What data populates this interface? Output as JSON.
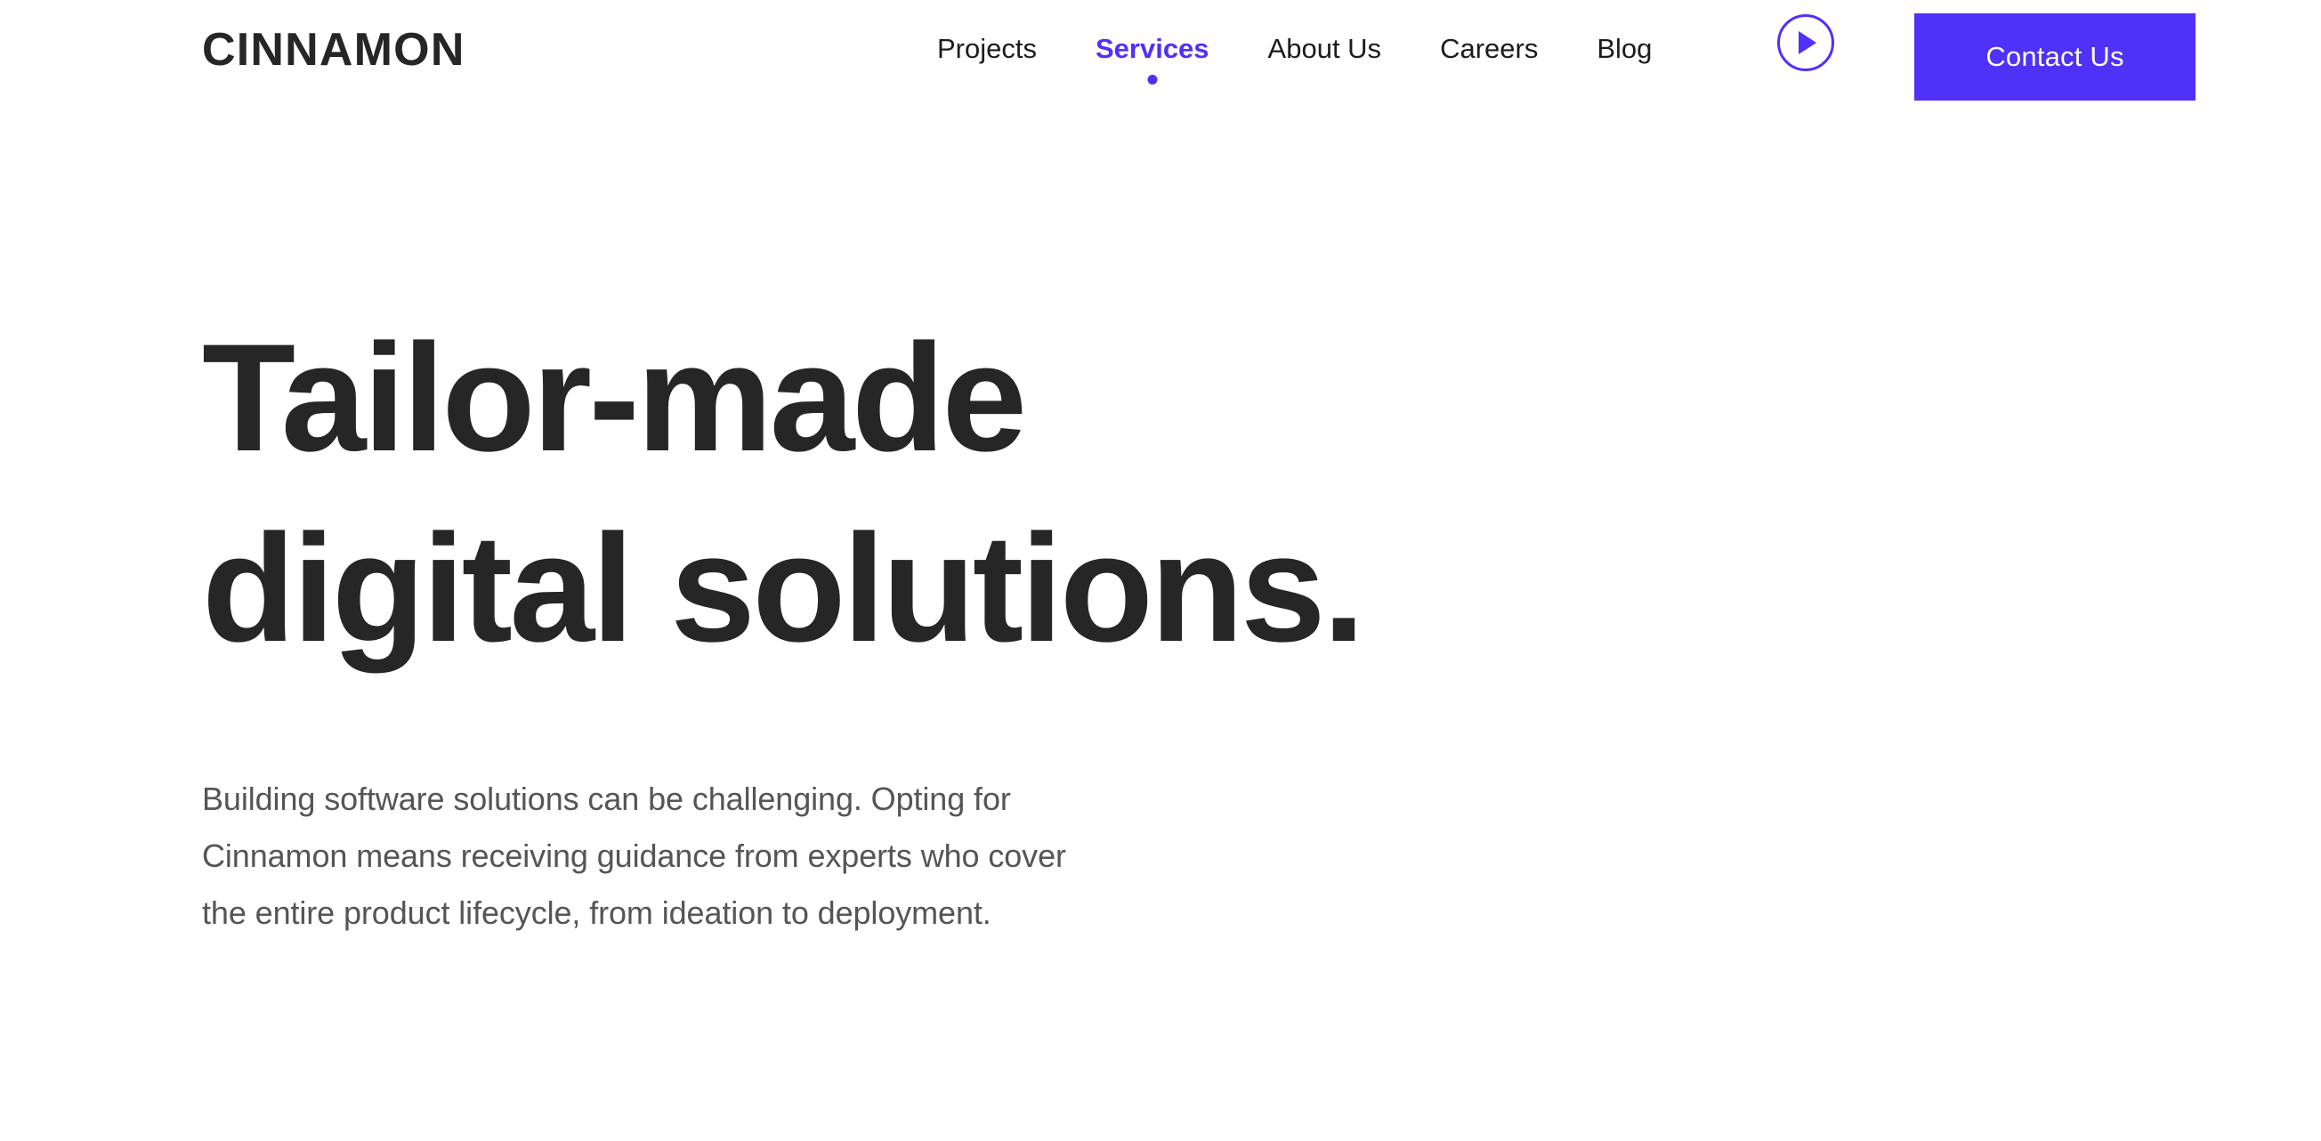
{
  "brand": {
    "logo_text": "CINNAMON",
    "accent_color": "#4f31f7",
    "heading_color": "#262626",
    "body_text_color": "#555555",
    "background_color": "#ffffff"
  },
  "header": {
    "nav": {
      "items": [
        {
          "label": "Projects",
          "active": false
        },
        {
          "label": "Services",
          "active": true
        },
        {
          "label": "About Us",
          "active": false
        },
        {
          "label": "Careers",
          "active": false
        },
        {
          "label": "Blog",
          "active": false
        }
      ]
    },
    "play_button": {
      "icon": "play-icon"
    },
    "cta": {
      "label": "Contact Us"
    }
  },
  "hero": {
    "title_lines": [
      "Tailor-made",
      "digital solutions."
    ],
    "paragraph_lines": [
      "Building software solutions can be challenging. Opting for",
      "Cinnamon means receiving guidance from experts who cover",
      "the entire product lifecycle, from ideation to deployment."
    ]
  }
}
